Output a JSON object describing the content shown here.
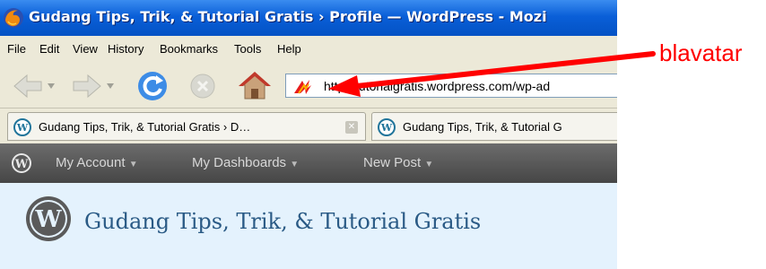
{
  "window": {
    "title": "Gudang Tips, Trik, & Tutorial Gratis › Profile — WordPress - Mozi",
    "icon": "firefox-logo"
  },
  "menu": {
    "items": [
      "File",
      "Edit",
      "View",
      "History",
      "Bookmarks",
      "Tools",
      "Help"
    ]
  },
  "navigation": {
    "url": "http://tutorialgratis.wordpress.com/wp-ad",
    "site_icon": "blavatar-icon"
  },
  "tabs": [
    {
      "label": "Gudang Tips, Trik, & Tutorial Gratis › D…",
      "icon": "wordpress-icon"
    },
    {
      "label": "Gudang Tips, Trik, & Tutorial G",
      "icon": "wordpress-icon"
    }
  ],
  "admin_bar": {
    "items": [
      "My Account",
      "My Dashboards",
      "New Post"
    ]
  },
  "blog": {
    "title": "Gudang Tips, Trik, & Tutorial Gratis"
  },
  "annotation": {
    "label": "blavatar",
    "color": "#ff0000"
  }
}
